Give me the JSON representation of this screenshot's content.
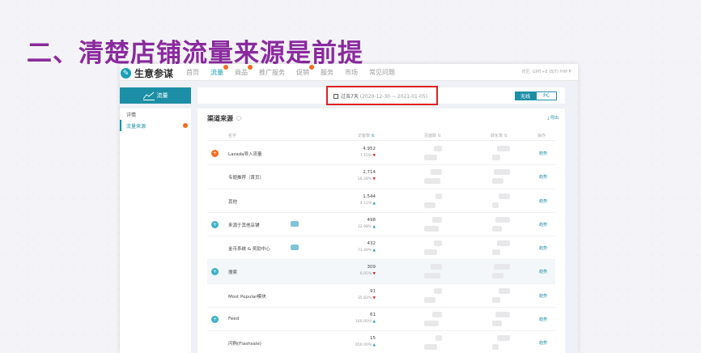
{
  "slide_title": "二、清楚店铺流量来源是前提",
  "app": {
    "logo_icon": "leaf-icon",
    "name": "生意参谋",
    "timezone": "时区: GMT+8 (BJT)  PHP ₱"
  },
  "nav_tabs": [
    {
      "label": "首页",
      "active": false,
      "dot": false
    },
    {
      "label": "流量",
      "active": true,
      "dot": true
    },
    {
      "label": "商品",
      "active": false,
      "dot": true
    },
    {
      "label": "推广服务",
      "active": false,
      "dot": false
    },
    {
      "label": "促销",
      "active": false,
      "dot": true
    },
    {
      "label": "服务",
      "active": false,
      "dot": false
    },
    {
      "label": "市场",
      "active": false,
      "dot": false
    },
    {
      "label": "常见问题",
      "active": false,
      "dot": false
    }
  ],
  "sidebar": {
    "header": "流量",
    "items": [
      {
        "label": "详情",
        "active": false
      },
      {
        "label": "流量来源",
        "active": true
      }
    ]
  },
  "date_filter": {
    "label": "过去7天",
    "range": "(2020-12-30 ~ 2021-01-05)"
  },
  "device_toggle": [
    "无线",
    "PC"
  ],
  "panel": {
    "title": "渠道来源",
    "export": "导出",
    "columns": [
      "名字",
      "访客数",
      "页面数",
      "转化率",
      "操作"
    ]
  },
  "rows": [
    {
      "icon": "plus-icon",
      "icon_color": "orange",
      "name": "Lazada导入流量",
      "value": "4,952",
      "pct": "7.15%",
      "trend": "down",
      "badge": false,
      "action": "趋势",
      "highlight": false
    },
    {
      "icon": "",
      "icon_color": "",
      "name": "专题推荐（首页）",
      "value": "2,714",
      "pct": "16.28%",
      "trend": "down",
      "badge": false,
      "action": "趋势",
      "highlight": false
    },
    {
      "icon": "",
      "icon_color": "",
      "name": "其他",
      "value": "1,544",
      "pct": "4.12%",
      "trend": "up",
      "badge": false,
      "action": "趋势",
      "highlight": false
    },
    {
      "icon": "plus-icon",
      "icon_color": "blue",
      "name": "来源于其他店铺",
      "value": "498",
      "pct": "32.98%",
      "trend": "up",
      "badge": true,
      "action": "趋势",
      "highlight": false
    },
    {
      "icon": "",
      "icon_color": "",
      "name": "金币系统 & 奖励中心",
      "value": "432",
      "pct": "73.49%",
      "trend": "up",
      "badge": true,
      "action": "趋势",
      "highlight": false
    },
    {
      "icon": "plus-icon",
      "icon_color": "blue",
      "name": "搜索",
      "value": "309",
      "pct": "6.05%",
      "trend": "down",
      "badge": false,
      "action": "趋势",
      "highlight": true
    },
    {
      "icon": "",
      "icon_color": "",
      "name": "Most Popular模块",
      "value": "91",
      "pct": "35.82%",
      "trend": "down",
      "badge": false,
      "action": "趋势",
      "highlight": false
    },
    {
      "icon": "plus-icon",
      "icon_color": "blue",
      "name": "Feed",
      "value": "61",
      "pct": "160.00%",
      "trend": "up",
      "badge": false,
      "action": "趋势",
      "highlight": false
    },
    {
      "icon": "",
      "icon_color": "",
      "name": "闪购(Flashsale)",
      "value": "15",
      "pct": "650.00%",
      "trend": "up",
      "badge": false,
      "action": "趋势",
      "highlight": false
    }
  ]
}
